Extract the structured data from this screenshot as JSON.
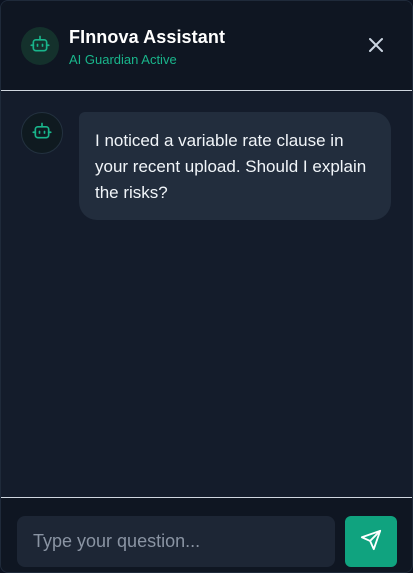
{
  "header": {
    "title": "FInnova Assistant",
    "status": "AI Guardian Active",
    "avatar_icon": "robot-icon",
    "close_icon": "close-icon"
  },
  "messages": [
    {
      "sender": "assistant",
      "avatar_icon": "robot-icon",
      "text": "I noticed a variable rate clause in your recent upload. Should I explain the risks?"
    }
  ],
  "composer": {
    "placeholder": "Type your question...",
    "value": "",
    "send_icon": "send-icon"
  },
  "colors": {
    "accent": "#10a37f",
    "status_text": "#19b58b",
    "panel_bg": "#141c2b",
    "header_bg": "#0f1622",
    "bubble_bg": "#222d3d"
  }
}
